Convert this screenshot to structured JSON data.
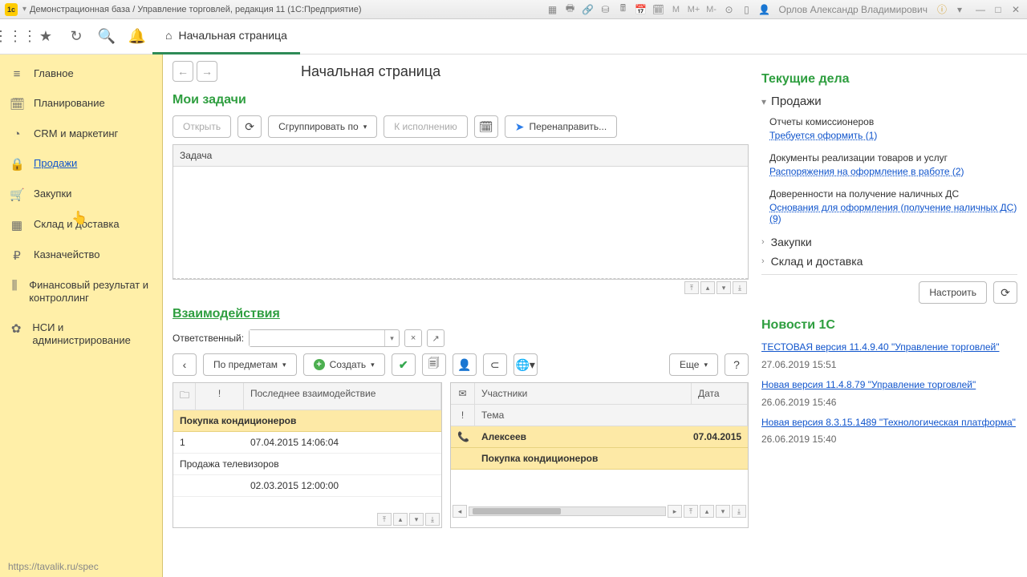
{
  "titlebar": {
    "app_title": "Демонстрационная база / Управление торговлей, редакция 11 (1С:Предприятие)",
    "user": "Орлов Александр Владимирович"
  },
  "toolbar": {
    "tab_home": "Начальная страница"
  },
  "sidebar": {
    "items": [
      {
        "icon": "≡",
        "label": "Главное"
      },
      {
        "icon": "🗓",
        "label": "Планирование"
      },
      {
        "icon": "◔",
        "label": "CRM и маркетинг"
      },
      {
        "icon": "🔒",
        "label": "Продажи"
      },
      {
        "icon": "🛒",
        "label": "Закупки"
      },
      {
        "icon": "▦",
        "label": "Склад и доставка"
      },
      {
        "icon": "₽",
        "label": "Казначейство"
      },
      {
        "icon": "⫼",
        "label": "Финансовый результат и контроллинг"
      },
      {
        "icon": "✿",
        "label": "НСИ и администрирование"
      }
    ],
    "status": "https://tavalik.ru/spec"
  },
  "page": {
    "title": "Начальная страница"
  },
  "tasks": {
    "heading": "Мои задачи",
    "open_btn": "Открыть",
    "group_btn": "Сгруппировать по",
    "execute_btn": "К исполнению",
    "redirect_btn": "Перенаправить...",
    "column": "Задача"
  },
  "interactions": {
    "heading": "Взаимодействия",
    "responsible_lbl": "Ответственный:",
    "by_subjects_btn": "По предметам",
    "create_btn": "Создать",
    "more_btn": "Еще",
    "help_btn": "?",
    "left_table": {
      "cols": [
        "",
        "!",
        "Последнее взаимодействие"
      ],
      "rows": [
        {
          "title": "Покупка кондиционеров",
          "num": "1",
          "date": "07.04.2015 14:06:04",
          "yellow": true
        },
        {
          "title": "Продажа телевизоров",
          "num": "",
          "date": "02.03.2015 12:00:00",
          "yellow": false
        }
      ]
    },
    "right_table": {
      "cols": [
        "✉",
        "Участники",
        "Дата"
      ],
      "header2": [
        "!",
        "Тема"
      ],
      "rows": [
        {
          "participant": "Алексеев",
          "date": "07.04.2015",
          "theme": "Покупка кондиционеров"
        }
      ]
    }
  },
  "affairs": {
    "heading": "Текущие дела",
    "top_cat": "Продажи",
    "items": [
      {
        "title": "Отчеты комиссионеров",
        "link": "Требуется оформить (1)"
      },
      {
        "title": "Документы реализации товаров и услуг",
        "link": "Распоряжения на оформление в работе (2)"
      },
      {
        "title": "Доверенности на получение наличных ДС",
        "link": "Основания для оформления (получение наличных ДС) (9)"
      }
    ],
    "cats": [
      "Закупки",
      "Склад и доставка"
    ],
    "configure_btn": "Настроить"
  },
  "news": {
    "heading": "Новости 1С",
    "items": [
      {
        "link": "ТЕСТОВАЯ версия 11.4.9.40 \"Управление торговлей\"",
        "date": "27.06.2019 15:51"
      },
      {
        "link": "Новая версия 11.4.8.79 \"Управление торговлей\"",
        "date": "26.06.2019 15:46"
      },
      {
        "link": "Новая версия 8.3.15.1489 \"Технологическая платформа\"",
        "date": "26.06.2019 15:40"
      }
    ]
  }
}
